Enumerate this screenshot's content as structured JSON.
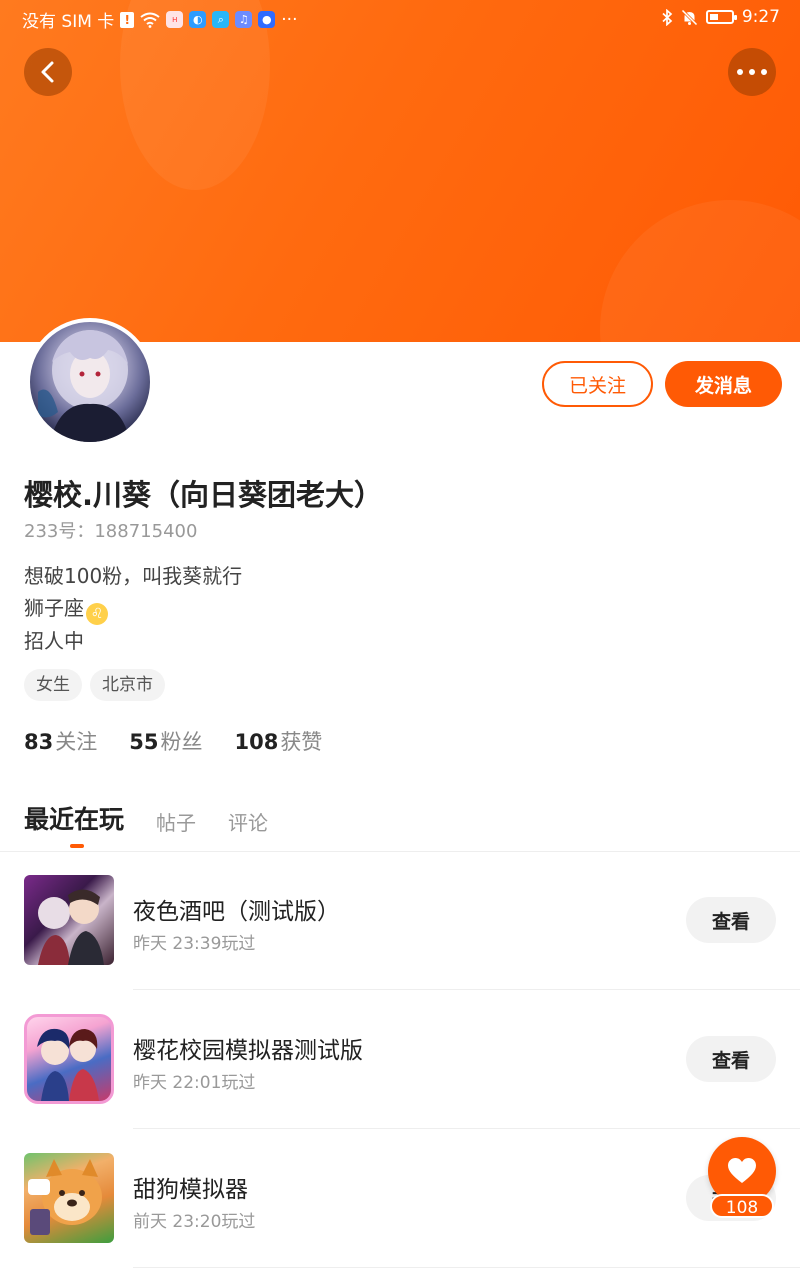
{
  "status_bar": {
    "carrier": "没有 SIM 卡",
    "time": "9:27",
    "battery_level": 0.3
  },
  "header": {
    "back_icon": "chevron-left-icon",
    "more_icon": "more-dots-icon"
  },
  "profile": {
    "follow_button": "已关注",
    "message_button": "发消息",
    "name": "樱校.川葵（向日葵团老大）",
    "id_label": "233号：",
    "id_value": "188715400",
    "bio": [
      "想破100粉，叫我葵就行",
      "狮子座",
      "招人中"
    ],
    "zodiac_icon": "leo-zodiac-icon",
    "tags": [
      "女生",
      "北京市"
    ],
    "stats": {
      "following_count": "83",
      "following_label": "关注",
      "followers_count": "55",
      "followers_label": "粉丝",
      "likes_count": "108",
      "likes_label": "获赞"
    }
  },
  "tabs": [
    "最近在玩",
    "帖子",
    "评论"
  ],
  "games": [
    {
      "name": "夜色酒吧（测试版）",
      "played": "昨天 23:39玩过",
      "button": "查看"
    },
    {
      "name": "樱花校园模拟器测试版",
      "played": "昨天 22:01玩过",
      "button": "查看"
    },
    {
      "name": "甜狗模拟器",
      "played": "前天 23:20玩过",
      "button": "查看"
    }
  ],
  "like_fab": {
    "icon": "heart-icon",
    "count": "108"
  },
  "colors": {
    "accent": "#ff5a05",
    "banner": "#ff6a0f"
  }
}
